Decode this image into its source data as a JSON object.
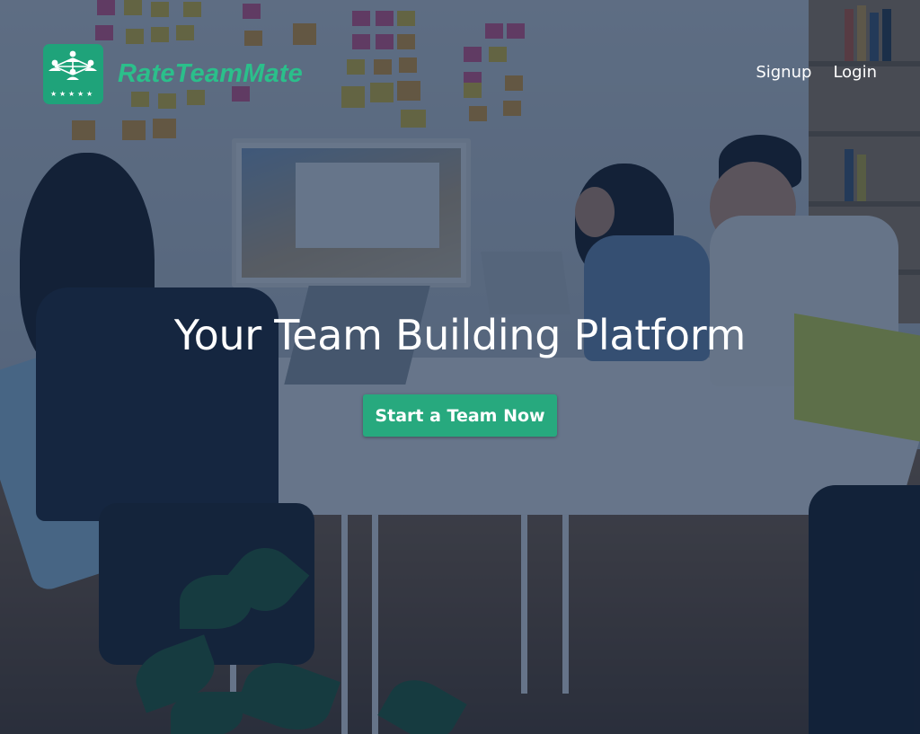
{
  "header": {
    "brand_name": "RateTeamMate",
    "logo_icon": "team-network-with-five-stars-icon",
    "nav": [
      {
        "label": "Signup"
      },
      {
        "label": "Login"
      }
    ]
  },
  "hero": {
    "headline": "Your Team Building Platform",
    "cta_label": "Start a Team Now",
    "background": "office-team-at-table-photo"
  },
  "colors": {
    "brand": "#2bbf8b",
    "button": "#27a97e",
    "overlay": "#122848"
  }
}
